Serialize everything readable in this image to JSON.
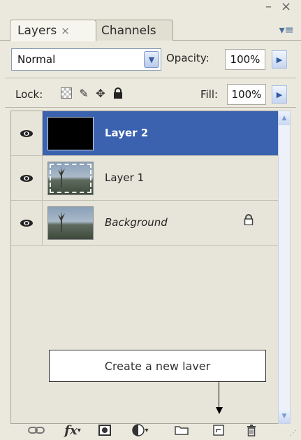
{
  "window": {
    "minimize_glyph": "–",
    "close_glyph": "×",
    "menu_glyph": "▾≡"
  },
  "tabs": [
    {
      "label": "Layers",
      "close": "×"
    },
    {
      "label": "Channels"
    }
  ],
  "blend_mode": {
    "value": "Normal"
  },
  "opacity": {
    "label": "Opacity:",
    "value": "100%"
  },
  "lock": {
    "label": "Lock:",
    "icons": [
      "lock-transparent-icon",
      "lock-image-icon",
      "lock-position-icon",
      "lock-all-icon"
    ]
  },
  "fill": {
    "label": "Fill:",
    "value": "100%"
  },
  "layers": [
    {
      "name": "Layer 2",
      "visible": true,
      "selected": true,
      "thumbnail": "black"
    },
    {
      "name": "Layer 1",
      "visible": true,
      "selected": false,
      "thumbnail": "landscape-selection"
    },
    {
      "name": "Background",
      "visible": true,
      "selected": false,
      "thumbnail": "landscape",
      "locked": true
    }
  ],
  "tooltip": {
    "text": "Create a new laver"
  },
  "toolbar": [
    "link-layers-icon",
    "fx-icon",
    "add-mask-icon",
    "adjustment-layer-icon",
    "new-group-icon",
    "new-layer-icon",
    "delete-layer-icon"
  ],
  "colors": {
    "selection": "#3a62ae",
    "panel": "#ebe9dd"
  }
}
